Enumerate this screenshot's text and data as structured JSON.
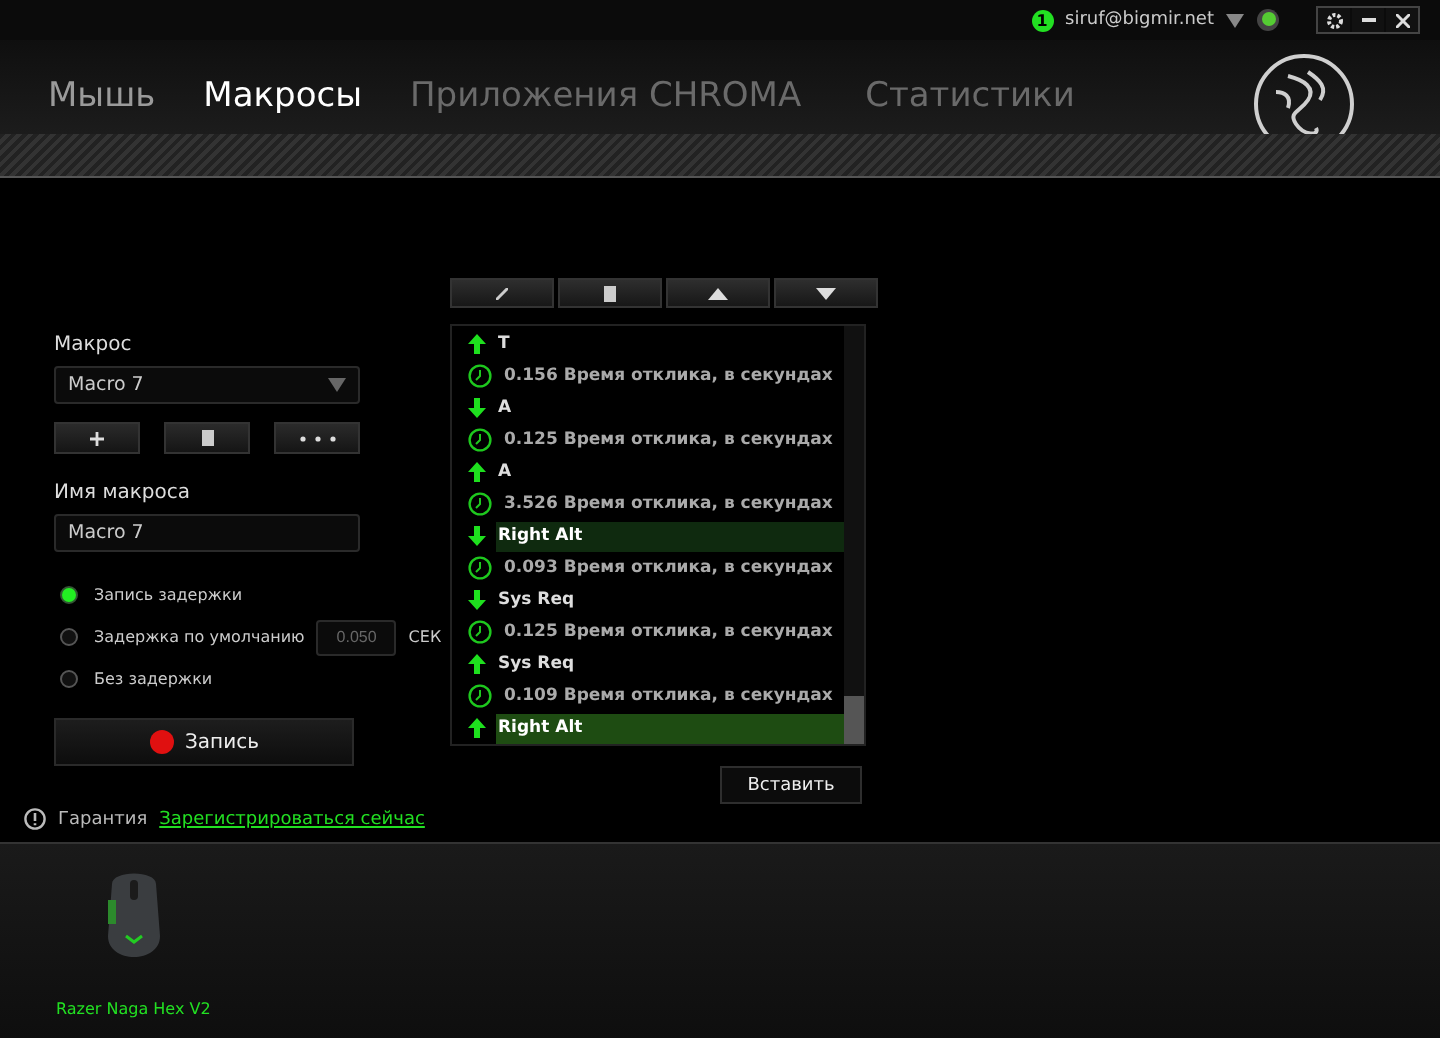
{
  "top_bar": {
    "notification_count": "1",
    "account": "siruf@bigmir.net"
  },
  "tabs": [
    {
      "label": "Мышь",
      "selected": false,
      "disabled": false
    },
    {
      "label": "Макросы",
      "selected": true,
      "disabled": false
    },
    {
      "label": "Приложения CHROMA",
      "selected": false,
      "disabled": true
    },
    {
      "label": "Статистики",
      "selected": false,
      "disabled": true
    }
  ],
  "macro_panel": {
    "macro_label": "Макрос",
    "macro_select": "Macro 7",
    "name_label": "Имя макроса",
    "name_value": "Macro 7",
    "delay_options": [
      {
        "label": "Запись задержки",
        "selected": true
      },
      {
        "label": "Задержка по умолчанию",
        "selected": false
      },
      {
        "label": "Без задержки",
        "selected": false
      }
    ],
    "default_delay": {
      "placeholder": "0.050",
      "unit": "СЕК"
    },
    "record_button": "Запись"
  },
  "events": [
    {
      "kind": "up",
      "text": "T",
      "selected": false,
      "hovered": false
    },
    {
      "kind": "delay",
      "text": "0.156 Время отклика, в секундах",
      "selected": false,
      "hovered": false
    },
    {
      "kind": "down",
      "text": "A",
      "selected": false,
      "hovered": false
    },
    {
      "kind": "delay",
      "text": "0.125 Время отклика, в секундах",
      "selected": false,
      "hovered": false
    },
    {
      "kind": "up",
      "text": "A",
      "selected": false,
      "hovered": false
    },
    {
      "kind": "delay",
      "text": "3.526 Время отклика, в секундах",
      "selected": false,
      "hovered": false
    },
    {
      "kind": "down",
      "text": "Right Alt",
      "selected": false,
      "hovered": true
    },
    {
      "kind": "delay",
      "text": "0.093 Время отклика, в секундах",
      "selected": false,
      "hovered": false
    },
    {
      "kind": "down",
      "text": "Sys Req",
      "selected": false,
      "hovered": false
    },
    {
      "kind": "delay",
      "text": "0.125 Время отклика, в секундах",
      "selected": false,
      "hovered": false
    },
    {
      "kind": "up",
      "text": "Sys Req",
      "selected": false,
      "hovered": false
    },
    {
      "kind": "delay",
      "text": "0.109 Время отклика, в секундах",
      "selected": false,
      "hovered": false
    },
    {
      "kind": "up",
      "text": "Right Alt",
      "selected": true,
      "hovered": false
    }
  ],
  "insert_button": "Вставить",
  "warranty": {
    "label": "Гарантия",
    "link": "Зарегистрироваться сейчас"
  },
  "device": {
    "name": "Razer Naga Hex V2"
  }
}
